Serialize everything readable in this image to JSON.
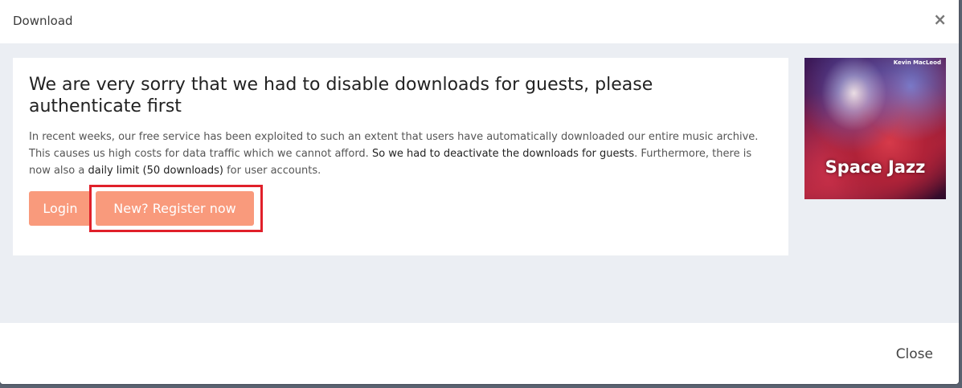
{
  "header": {
    "title": "Download",
    "close_symbol": "×"
  },
  "card": {
    "heading": "We are very sorry that we had to disable downloads for guests, please authenticate first",
    "paragraph_part1": "In recent weeks, our free service has been exploited to such an extent that users have automatically downloaded our entire music archive. This causes us high costs for data traffic which we cannot afford. ",
    "paragraph_strong1": "So we had to deactivate the downloads for guests",
    "paragraph_part2": ". Furthermore, there is now also a ",
    "paragraph_strong2": "daily limit (50 downloads)",
    "paragraph_part3": " for user accounts.",
    "login_label": "Login",
    "register_label": "New? Register now"
  },
  "album": {
    "artist": "Kevin MacLeod",
    "title": "Space Jazz"
  },
  "footer": {
    "close_label": "Close"
  },
  "colors": {
    "button": "#f99a7c",
    "highlight": "#e0202a",
    "body_bg": "#ebeef3"
  }
}
